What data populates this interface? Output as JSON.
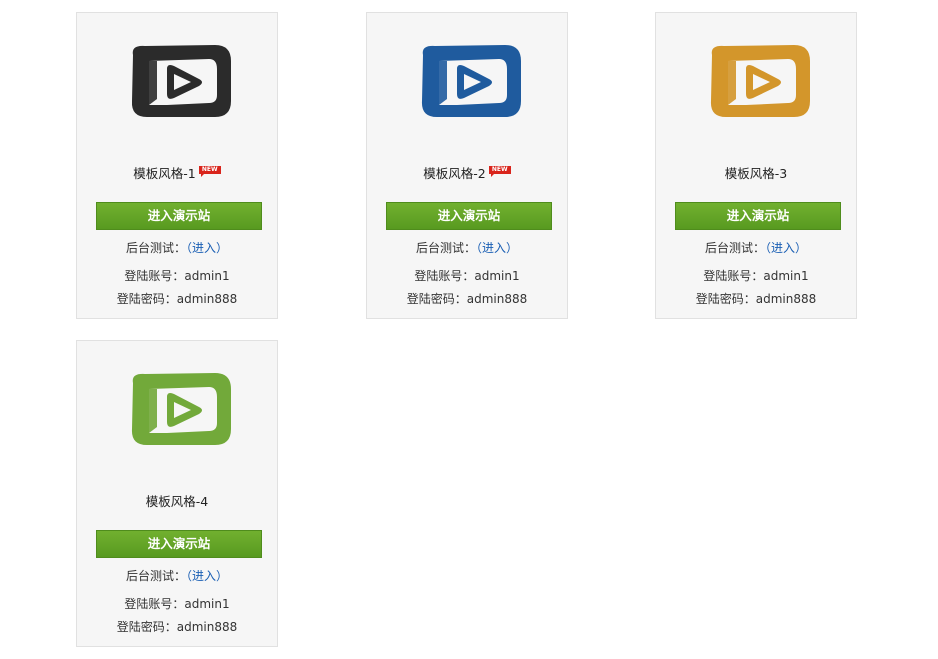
{
  "templates": [
    {
      "title": "模板风格-1",
      "badge": "NEW",
      "color": "#2b2b2b",
      "icon": "play-screen-icon",
      "enter_button": "进入演示站",
      "admin_label": "后台测试：",
      "admin_link": "（进入）",
      "account_label": "登陆账号：",
      "account_value": "admin1",
      "password_label": "登陆密码：",
      "password_value": "admin888"
    },
    {
      "title": "模板风格-2",
      "badge": "NEW",
      "color": "#1f5b9e",
      "icon": "play-screen-icon",
      "enter_button": "进入演示站",
      "admin_label": "后台测试：",
      "admin_link": "（进入）",
      "account_label": "登陆账号：",
      "account_value": "admin1",
      "password_label": "登陆密码：",
      "password_value": "admin888"
    },
    {
      "title": "模板风格-3",
      "badge": "",
      "color": "#d3962b",
      "icon": "play-screen-icon",
      "enter_button": "进入演示站",
      "admin_label": "后台测试：",
      "admin_link": "（进入）",
      "account_label": "登陆账号：",
      "account_value": "admin1",
      "password_label": "登陆密码：",
      "password_value": "admin888"
    },
    {
      "title": "模板风格-4",
      "badge": "",
      "color": "#72a93a",
      "icon": "play-screen-icon",
      "enter_button": "进入演示站",
      "admin_label": "后台测试：",
      "admin_link": "（进入）",
      "account_label": "登陆账号：",
      "account_value": "admin1",
      "password_label": "登陆密码：",
      "password_value": "admin888"
    }
  ]
}
